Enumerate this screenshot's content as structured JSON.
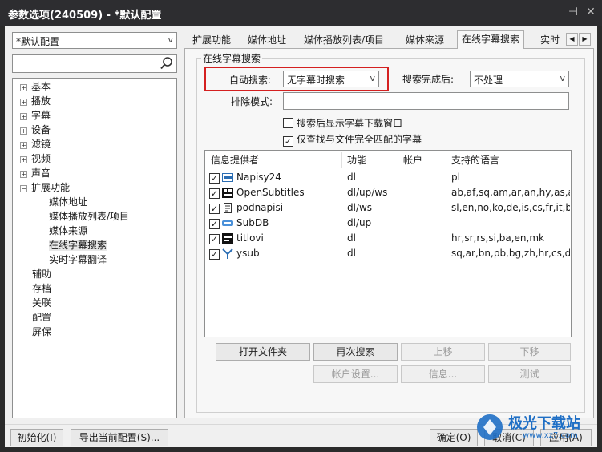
{
  "window": {
    "title": "参数选项(240509) - *默认配置",
    "pin_glyph": "⊣",
    "close_glyph": "✕"
  },
  "profile": {
    "value": "*默认配置",
    "arrow": "v"
  },
  "tree": {
    "items": [
      {
        "label": "基本",
        "expander": "+"
      },
      {
        "label": "播放",
        "expander": "+"
      },
      {
        "label": "字幕",
        "expander": "+"
      },
      {
        "label": "设备",
        "expander": "+"
      },
      {
        "label": "滤镜",
        "expander": "+"
      },
      {
        "label": "视频",
        "expander": "+"
      },
      {
        "label": "声音",
        "expander": "+"
      },
      {
        "label": "扩展功能",
        "expander": "−"
      },
      {
        "label": "媒体地址"
      },
      {
        "label": "媒体播放列表/项目"
      },
      {
        "label": "媒体来源"
      },
      {
        "label": "在线字幕搜索",
        "selected": true
      },
      {
        "label": "实时字幕翻译"
      },
      {
        "label": "辅助"
      },
      {
        "label": "存档"
      },
      {
        "label": "关联"
      },
      {
        "label": "配置"
      },
      {
        "label": "屏保"
      }
    ]
  },
  "tabs": [
    "扩展功能",
    "媒体地址",
    "媒体播放列表/项目",
    "媒体来源",
    "在线字幕搜索",
    "实时"
  ],
  "tab_scroll": {
    "left": "◀",
    "right": "▶"
  },
  "group_title": "在线字幕搜索",
  "form": {
    "auto_search_label": "自动搜索:",
    "auto_search_value": "无字幕时搜索",
    "after_search_label": "搜索完成后:",
    "after_search_value": "不处理",
    "exclude_label": "排除模式:",
    "exclude_value": "",
    "show_download_window": "搜索后显示字幕下载窗口",
    "exact_match_only": "仅查找与文件完全匹配的字幕",
    "check_mark": "✓",
    "arrow": "v"
  },
  "providers": {
    "headers": [
      "信息提供者",
      "功能",
      "帐户",
      "支持的语言"
    ],
    "rows": [
      {
        "name": "Napisy24",
        "func": "dl",
        "account": "",
        "langs": "pl",
        "icon": "napisy24-icon"
      },
      {
        "name": "OpenSubtitles",
        "func": "dl/up/ws",
        "account": "",
        "langs": "ab,af,sq,am,ar,an,hy,as,a",
        "icon": "opensubtitles-icon"
      },
      {
        "name": "podnapisi",
        "func": "dl/ws",
        "account": "",
        "langs": "sl,en,no,ko,de,is,cs,fr,it,b",
        "icon": "podnapisi-icon"
      },
      {
        "name": "SubDB",
        "func": "dl/up",
        "account": "",
        "langs": "",
        "icon": "subdb-icon"
      },
      {
        "name": "titlovi",
        "func": "dl",
        "account": "",
        "langs": "hr,sr,rs,si,ba,en,mk",
        "icon": "titlovi-icon"
      },
      {
        "name": "ysub",
        "func": "dl",
        "account": "",
        "langs": "sq,ar,bn,pb,bg,zh,hr,cs,d",
        "icon": "ysub-icon"
      }
    ]
  },
  "buttons": {
    "open_folder": "打开文件夹",
    "search_again": "再次搜索",
    "move_up": "上移",
    "move_down": "下移",
    "account_settings": "帐户设置...",
    "info": "信息...",
    "test": "测试",
    "initialize": "初始化(I)",
    "export_config": "导出当前配置(S)...",
    "ok": "确定(O)",
    "cancel": "取消(C)",
    "apply": "应用(A)"
  },
  "watermark": {
    "text": "极光下载站",
    "url_text": "www.xz7.com"
  },
  "colors": {
    "highlight": "#d42020",
    "titlebar": "#2d2d30",
    "watermark_blue": "#1f6fc5"
  }
}
